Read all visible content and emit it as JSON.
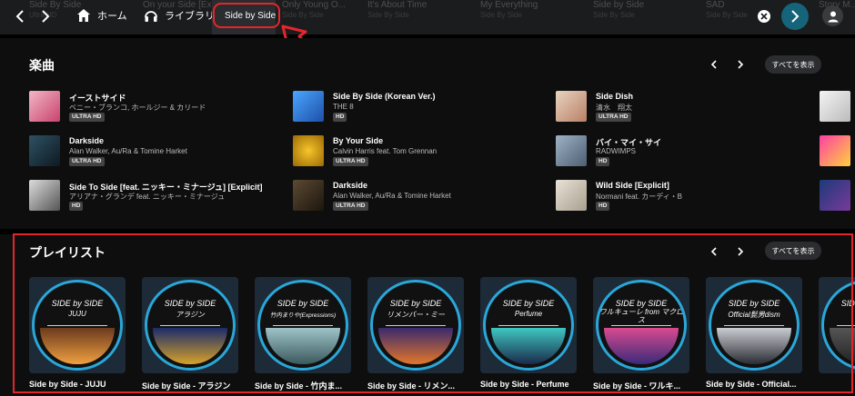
{
  "topbar": {
    "ghost_items": [
      {
        "title": "Side By Side",
        "sub": "Ultra HD"
      },
      {
        "title": "On your Side [Ex...",
        "sub": ""
      },
      {
        "title": "Only Young O...",
        "sub": "Side By Side"
      },
      {
        "title": "It's About Time",
        "sub": "Side By Side"
      },
      {
        "title": "My Everything",
        "sub": "Side By Side"
      },
      {
        "title": "Side by Side",
        "sub": "Side By Side"
      },
      {
        "title": "SAD",
        "sub": "Side By Side"
      },
      {
        "title": "Story M...",
        "sub": ""
      }
    ],
    "home_label": "ホーム",
    "library_label": "ライブラリ",
    "search_value": "Side by Side",
    "icons": {
      "back": "chevron-left-icon",
      "forward": "chevron-right-icon",
      "home": "home-icon",
      "library": "headphones-icon",
      "clear": "close-icon",
      "go": "arrow-right-icon",
      "avatar": "user-icon"
    },
    "colors": {
      "go_button": "#15647a",
      "annotation": "#e4262c"
    }
  },
  "songs": {
    "title": "楽曲",
    "show_all": "すべてを表示",
    "items": [
      {
        "title": "イーストサイド",
        "artist": "ベニー・ブランコ, ホールジー & カリード",
        "badge": "ULTRA HD",
        "art": "linear-gradient(135deg,#f2b6c6,#c9436d)"
      },
      {
        "title": "Side By Side (Korean Ver.)",
        "artist": "THE 8",
        "badge": "HD",
        "art": "linear-gradient(135deg,#4aa6ff,#1f4fa8)"
      },
      {
        "title": "Side Dish",
        "artist": "清水　翔太",
        "badge": "ULTRA HD",
        "art": "linear-gradient(135deg,#e8d4c0,#b97f66)"
      },
      {
        "title": "Darkside",
        "artist": "Alan Walker, Au/Ra & Tomine Harket",
        "badge": "ULTRA HD",
        "art": "linear-gradient(135deg,#2e5163,#0e1a22)"
      },
      {
        "title": "By Your Side",
        "artist": "Calvin Harris feat. Tom Grennan",
        "badge": "ULTRA HD",
        "art": "radial-gradient(circle,#f7c52a,#9b6a06)"
      },
      {
        "title": "バイ・マイ・サイ",
        "artist": "RADWIMPS",
        "badge": "HD",
        "art": "linear-gradient(135deg,#9fb2c5,#4d5f72)"
      },
      {
        "title": "Side To Side [feat. ニッキー・ミナージュ] [Explicit]",
        "artist": "アリアナ・グランデ feat. ニッキー・ミナージュ",
        "badge": "HD",
        "art": "linear-gradient(135deg,#ddd,#555)"
      },
      {
        "title": "Darkside",
        "artist": "Alan Walker, Au/Ra & Tomine Harket",
        "badge": "ULTRA HD",
        "art": "linear-gradient(135deg,#5c4a32,#1c160e)"
      },
      {
        "title": "Wild Side [Explicit]",
        "artist": "Normani feat. カーディ・B",
        "badge": "HD",
        "art": "linear-gradient(135deg,#e9e2d6,#a79f8f)"
      }
    ]
  },
  "playlists": {
    "title": "プレイリスト",
    "show_all": "すべてを表示",
    "items": [
      {
        "cover_top": "SIDE by SIDE",
        "cover_sub": "JUJU",
        "name": "Side by Side - JUJU",
        "photo": "linear-gradient(180deg,#6b3a1e,#f0a040)"
      },
      {
        "cover_top": "SIDE by SIDE",
        "cover_sub": "アラジン",
        "name": "Side by Side - アラジン",
        "photo": "linear-gradient(180deg,#1a2c6a,#d7a12a)"
      },
      {
        "cover_top": "SIDE by SIDE",
        "cover_sub": "竹内まりや(Expressions)",
        "name": "Side by Side - 竹内ま...",
        "photo": "linear-gradient(180deg,#9ec3c8,#3b5a5e)"
      },
      {
        "cover_top": "SIDE by SIDE",
        "cover_sub": "リメンバー・ミー",
        "name": "Side by Side - リメン...",
        "photo": "linear-gradient(180deg,#3a2a6e,#e2762a)"
      },
      {
        "cover_top": "SIDE by SIDE",
        "cover_sub": "Perfume",
        "name": "Side by Side - Perfume",
        "photo": "linear-gradient(180deg,#3fc7c2,#1b2a4a)"
      },
      {
        "cover_top": "SIDE by SIDE",
        "cover_sub": "ワルキューレ from マクロス",
        "name": "Side by Side - ワルキ...",
        "photo": "linear-gradient(180deg,#d84a8f,#3b2a7a)"
      },
      {
        "cover_top": "SIDE by SIDE",
        "cover_sub": "Official髭男dism",
        "name": "Side by Side - Official...",
        "photo": "linear-gradient(180deg,#c9ccd2,#2a2c33)"
      },
      {
        "cover_top": "SIDE by SIDE",
        "cover_sub": "",
        "name": "",
        "photo": "linear-gradient(180deg,#555,#222)"
      }
    ]
  }
}
